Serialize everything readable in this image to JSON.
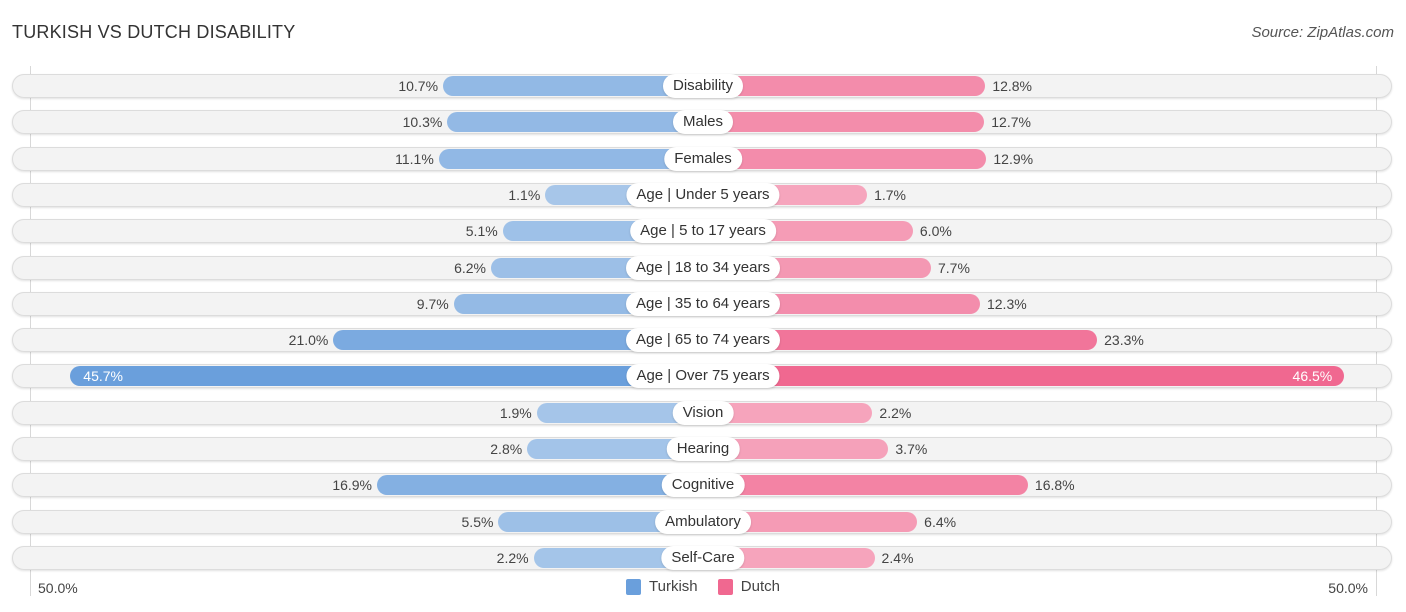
{
  "header": {
    "title": "TURKISH VS DUTCH DISABILITY",
    "source": "Source: ZipAtlas.com"
  },
  "colors": {
    "turkish": "#6a9fdc",
    "turkish_light": "#a9c8ea",
    "dutch": "#f06890",
    "dutch_light": "#f6a9c0"
  },
  "chart_data": {
    "type": "bar",
    "orientation": "horizontal-diverging",
    "title": "TURKISH VS DUTCH DISABILITY",
    "categories": [
      "Disability",
      "Males",
      "Females",
      "Age | Under 5 years",
      "Age | 5 to 17 years",
      "Age | 18 to 34 years",
      "Age | 35 to 64 years",
      "Age | 65 to 74 years",
      "Age | Over 75 years",
      "Vision",
      "Hearing",
      "Cognitive",
      "Ambulatory",
      "Self-Care"
    ],
    "series": [
      {
        "name": "Turkish",
        "side": "left",
        "values": [
          10.7,
          10.3,
          11.1,
          1.1,
          5.1,
          6.2,
          9.7,
          21.0,
          45.7,
          1.9,
          2.8,
          16.9,
          5.5,
          2.2
        ]
      },
      {
        "name": "Dutch",
        "side": "right",
        "values": [
          12.8,
          12.7,
          12.9,
          1.7,
          6.0,
          7.7,
          12.3,
          23.3,
          46.5,
          2.2,
          3.7,
          16.8,
          6.4,
          2.4
        ]
      }
    ],
    "value_labels": {
      "Turkish": [
        "10.7%",
        "10.3%",
        "11.1%",
        "1.1%",
        "5.1%",
        "6.2%",
        "9.7%",
        "21.0%",
        "45.7%",
        "1.9%",
        "2.8%",
        "16.9%",
        "5.5%",
        "2.2%"
      ],
      "Dutch": [
        "12.8%",
        "12.7%",
        "12.9%",
        "1.7%",
        "6.0%",
        "7.7%",
        "12.3%",
        "23.3%",
        "46.5%",
        "2.2%",
        "3.7%",
        "16.8%",
        "6.4%",
        "2.4%"
      ]
    },
    "axis": {
      "left_label": "50.0%",
      "right_label": "50.0%",
      "range": [
        -50,
        50
      ]
    },
    "legend": {
      "position": "bottom-center",
      "entries": [
        "Turkish",
        "Dutch"
      ]
    },
    "grid": false
  }
}
